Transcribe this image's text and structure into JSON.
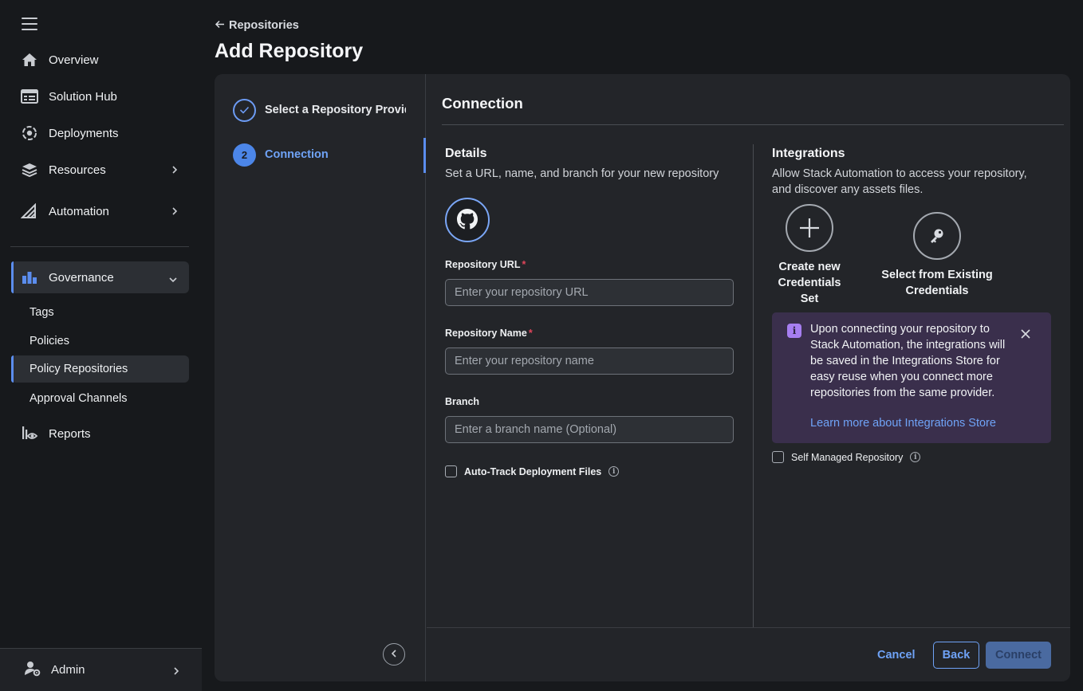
{
  "sidebar": {
    "items": [
      {
        "label": "Overview",
        "icon": "home-icon"
      },
      {
        "label": "Solution Hub",
        "icon": "solution-hub-icon"
      },
      {
        "label": "Deployments",
        "icon": "deployments-icon"
      },
      {
        "label": "Resources",
        "icon": "resources-icon"
      },
      {
        "label": "Automation",
        "icon": "automation-icon"
      },
      {
        "label": "Governance",
        "icon": "governance-icon"
      },
      {
        "label": "Reports",
        "icon": "reports-icon"
      }
    ],
    "governance_sub": [
      "Tags",
      "Policies",
      "Policy Repositories",
      "Approval Channels"
    ],
    "admin_label": "Admin",
    "accent": "#5b8dee"
  },
  "header": {
    "back_label": "Repositories",
    "title": "Add Repository"
  },
  "steps": [
    {
      "label": "Select a Repository Provider",
      "state": "done"
    },
    {
      "number": "2",
      "label": "Connection",
      "state": "current"
    }
  ],
  "content": {
    "title": "Connection",
    "details": {
      "title": "Details",
      "desc": "Set a URL, name, and branch for your new repository",
      "provider_icon": "github-icon",
      "url_label": "Repository URL",
      "url_placeholder": "Enter your repository URL",
      "name_label": "Repository Name",
      "name_placeholder": "Enter your repository name",
      "branch_label": "Branch",
      "branch_placeholder": "Enter a branch name (Optional)",
      "required_mark": "*",
      "autotrack_label": "Auto-Track Deployment Files"
    },
    "integrations": {
      "title": "Integrations",
      "desc_line1": "Allow Stack Automation to access your repository,",
      "desc_line2": "and discover any assets files.",
      "create_line1": "Create new",
      "create_line2": "Credentials",
      "create_line3": "Set",
      "select_line1": "Select from Existing",
      "select_line2": "Credentials",
      "notice_text": "Upon connecting your repository to Stack Automation, the integrations will be saved in the Integrations Store for easy reuse when you connect more repositories from the same provider.",
      "notice_link": "Learn more about Integrations Store",
      "self_managed_label": "Self Managed Repository",
      "notice_color": "#3a2f4c"
    }
  },
  "footer": {
    "cancel": "Cancel",
    "back": "Back",
    "connect": "Connect"
  }
}
